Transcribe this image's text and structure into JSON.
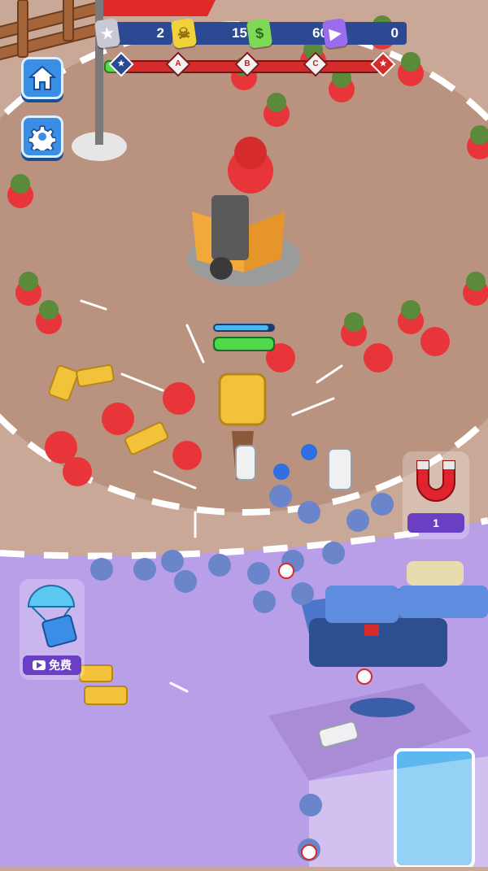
{
  "resources": [
    {
      "name": "badge-cards",
      "value": "2",
      "color": "#c9c9d6"
    },
    {
      "name": "skull-cards",
      "value": "15",
      "color": "#f2d23a"
    },
    {
      "name": "cash-cards",
      "value": "60",
      "color": "#7ed957"
    },
    {
      "name": "video-cards",
      "value": "0",
      "color": "#9b6cf0"
    }
  ],
  "progress": {
    "fraction": 0.06,
    "checkpoints": [
      "A",
      "B",
      "C"
    ]
  },
  "magnet": {
    "count": "1"
  },
  "airdrop": {
    "label": "免费"
  },
  "colors": {
    "ground": "#c9a897",
    "arena": "#b08d7b",
    "purple_zone": "#b99ee8",
    "enemy": "#e8353a",
    "enemy_helmet": "#5a8a3a",
    "ally": "#6a85c9",
    "hud_bar": "#2b4a93"
  }
}
